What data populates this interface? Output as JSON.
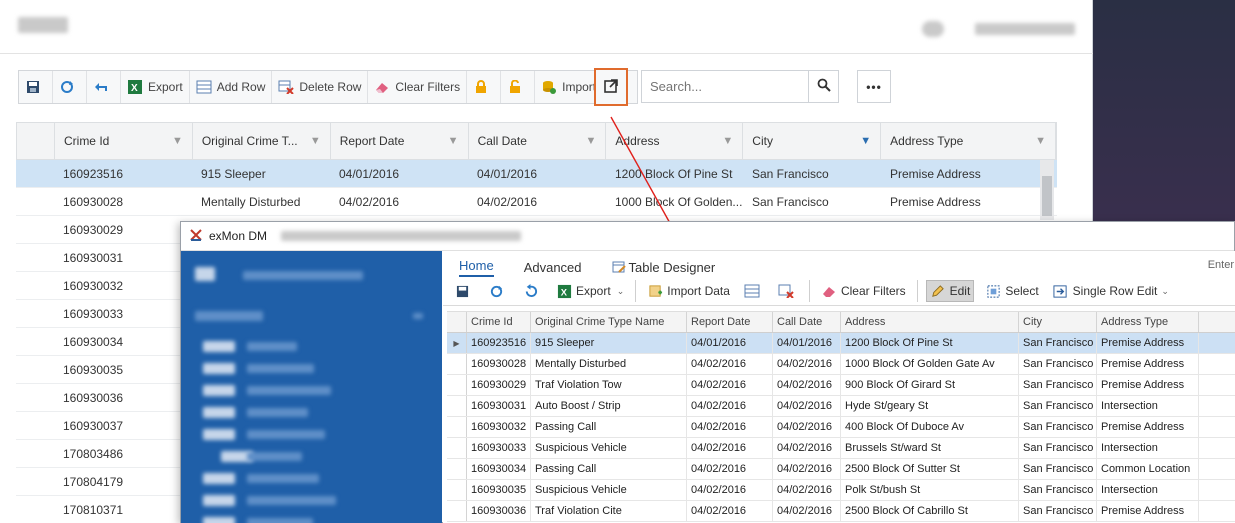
{
  "background_app": {
    "toolbar": {
      "export_label": "Export",
      "add_row_label": "Add Row",
      "delete_row_label": "Delete Row",
      "clear_filters_label": "Clear Filters",
      "import_data_label": "Import data"
    },
    "search": {
      "placeholder": "Search..."
    },
    "grid": {
      "columns": [
        "Crime Id",
        "Original Crime T...",
        "Report Date",
        "Call Date",
        "Address",
        "City",
        "Address Type"
      ],
      "rows": [
        [
          "160923516",
          "915 Sleeper",
          "04/01/2016",
          "04/01/2016",
          "1200 Block Of Pine St",
          "San Francisco",
          "Premise Address"
        ],
        [
          "160930028",
          "Mentally Disturbed",
          "04/02/2016",
          "04/02/2016",
          "1000 Block Of Golden...",
          "San Francisco",
          "Premise Address"
        ],
        [
          "160930029"
        ],
        [
          "160930031"
        ],
        [
          "160930032"
        ],
        [
          "160930033"
        ],
        [
          "160930034"
        ],
        [
          "160930035"
        ],
        [
          "160930036"
        ],
        [
          "160930037"
        ],
        [
          "170803486"
        ],
        [
          "170804179"
        ],
        [
          "170810371"
        ]
      ]
    }
  },
  "window": {
    "title": "exMon DM",
    "tabs": {
      "home": "Home",
      "advanced": "Advanced",
      "table_designer": "Table Designer"
    },
    "enter_hint": "Enter",
    "ribbon": {
      "export": "Export",
      "import_data": "Import Data",
      "clear_filters": "Clear Filters",
      "edit": "Edit",
      "select": "Select",
      "single_row_edit": "Single Row Edit"
    },
    "grid": {
      "columns": [
        "Crime Id",
        "Original Crime Type Name",
        "Report Date",
        "Call Date",
        "Address",
        "City",
        "Address Type"
      ],
      "rows": [
        [
          "160923516",
          "915 Sleeper",
          "04/01/2016",
          "04/01/2016",
          "1200 Block Of Pine St",
          "San Francisco",
          "Premise Address"
        ],
        [
          "160930028",
          "Mentally Disturbed",
          "04/02/2016",
          "04/02/2016",
          "1000 Block Of Golden Gate Av",
          "San Francisco",
          "Premise Address"
        ],
        [
          "160930029",
          "Traf Violation Tow",
          "04/02/2016",
          "04/02/2016",
          "900 Block Of Girard St",
          "San Francisco",
          "Premise Address"
        ],
        [
          "160930031",
          "Auto Boost / Strip",
          "04/02/2016",
          "04/02/2016",
          "Hyde St/geary St",
          "San Francisco",
          "Intersection"
        ],
        [
          "160930032",
          "Passing Call",
          "04/02/2016",
          "04/02/2016",
          "400 Block Of Duboce Av",
          "San Francisco",
          "Premise Address"
        ],
        [
          "160930033",
          "Suspicious Vehicle",
          "04/02/2016",
          "04/02/2016",
          "Brussels St/ward St",
          "San Francisco",
          "Intersection"
        ],
        [
          "160930034",
          "Passing Call",
          "04/02/2016",
          "04/02/2016",
          "2500 Block Of Sutter St",
          "San Francisco",
          "Common Location"
        ],
        [
          "160930035",
          "Suspicious Vehicle",
          "04/02/2016",
          "04/02/2016",
          "Polk St/bush St",
          "San Francisco",
          "Intersection"
        ],
        [
          "160930036",
          "Traf Violation Cite",
          "04/02/2016",
          "04/02/2016",
          "2500 Block Of Cabrillo St",
          "San Francisco",
          "Premise Address"
        ]
      ]
    }
  },
  "colors": {
    "highlight": "#e06b2d",
    "arrow": "#e0201b",
    "sidebar": "#1f5fa8",
    "selected_row": "#cfe3f5"
  }
}
